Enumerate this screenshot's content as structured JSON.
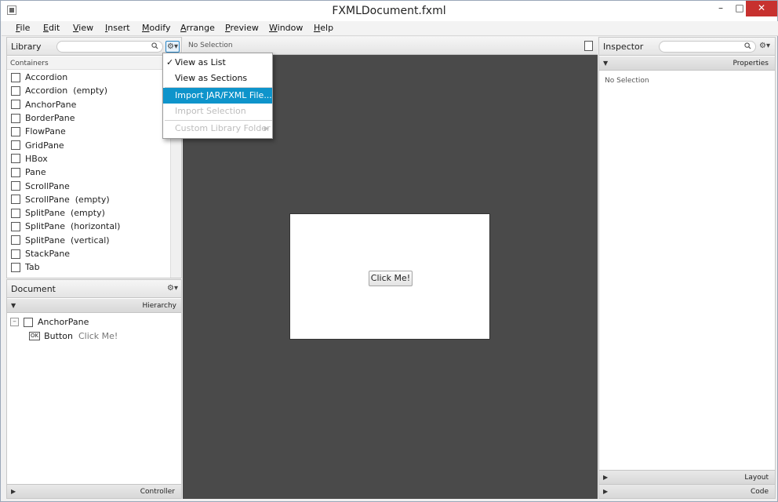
{
  "window": {
    "title": "FXMLDocument.fxml",
    "minimize": "–",
    "maximize": "□",
    "close": "✕"
  },
  "menubar": [
    {
      "label": "File",
      "mnemonic": "F",
      "rest": "ile"
    },
    {
      "label": "Edit",
      "mnemonic": "E",
      "rest": "dit"
    },
    {
      "label": "View",
      "mnemonic": "V",
      "rest": "iew"
    },
    {
      "label": "Insert",
      "mnemonic": "I",
      "rest": "nsert"
    },
    {
      "label": "Modify",
      "mnemonic": "M",
      "rest": "odify"
    },
    {
      "label": "Arrange",
      "mnemonic": "A",
      "rest": "rrange"
    },
    {
      "label": "Preview",
      "mnemonic": "P",
      "rest": "review"
    },
    {
      "label": "Window",
      "mnemonic": "W",
      "rest": "indow"
    },
    {
      "label": "Help",
      "mnemonic": "H",
      "rest": "elp"
    }
  ],
  "library": {
    "title": "Library",
    "search_placeholder": "",
    "section": "Containers",
    "items": [
      "Accordion",
      "Accordion  (empty)",
      "AnchorPane",
      "BorderPane",
      "FlowPane",
      "GridPane",
      "HBox",
      "Pane",
      "ScrollPane",
      "ScrollPane  (empty)",
      "SplitPane  (empty)",
      "SplitPane  (horizontal)",
      "SplitPane  (vertical)",
      "StackPane",
      "Tab"
    ]
  },
  "library_menu": {
    "items": [
      {
        "label": "View as List",
        "checked": true,
        "state": "normal"
      },
      {
        "label": "View as Sections",
        "checked": false,
        "state": "normal"
      },
      {
        "label": "Import JAR/FXML File...",
        "checked": false,
        "state": "highlighted"
      },
      {
        "label": "Import Selection",
        "checked": false,
        "state": "disabled"
      },
      {
        "label": "Custom Library Folder",
        "checked": false,
        "state": "disabled",
        "submenu": true
      }
    ]
  },
  "document": {
    "title": "Document",
    "hierarchy_label": "Hierarchy",
    "tree": [
      {
        "label": "AnchorPane",
        "suffix": ""
      },
      {
        "label": "Button",
        "suffix": "Click Me!"
      }
    ],
    "controller_label": "Controller"
  },
  "content": {
    "selection_status": "No Selection",
    "button_text": "Click Me!"
  },
  "inspector": {
    "title": "Inspector",
    "properties_label": "Properties",
    "selection_status": "No Selection",
    "layout_label": "Layout",
    "code_label": "Code"
  }
}
